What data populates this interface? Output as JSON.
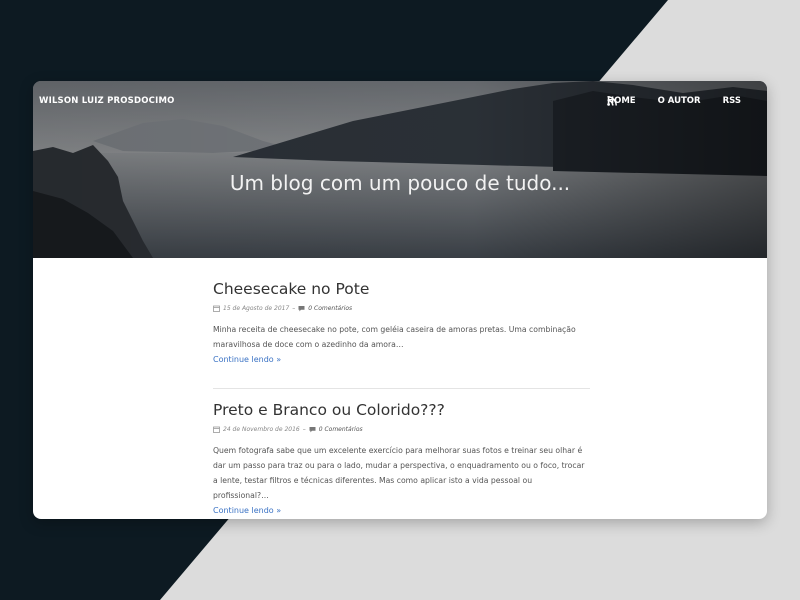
{
  "site": {
    "brand": "WILSON LUIZ PROSDOCIMO",
    "tagline": "Um blog com um pouco de tudo...",
    "nav": [
      {
        "label": "HOME"
      },
      {
        "label": "O AUTOR"
      },
      {
        "label": "RSS",
        "icon": "rss-icon"
      }
    ]
  },
  "posts": [
    {
      "title": "Cheesecake no Pote",
      "date": "15 de Agosto de 2017",
      "separator": "–",
      "comments": "0 Comentários",
      "excerpt": "Minha receita de cheesecake no pote, com geléia caseira de amoras pretas. Uma combinação maravilhosa de doce com o azedinho da amora…",
      "more": "Continue lendo »"
    },
    {
      "title": "Preto e Branco ou Colorido???",
      "date": "24 de Novembro de 2016",
      "separator": "–",
      "comments": "0 Comentários",
      "excerpt": "Quem fotografa sabe que um excelente exercício para melhorar suas fotos e treinar seu olhar é dar um passo para traz ou para o lado, mudar a perspectiva, o enquadramento ou o foco, trocar a lente, testar filtros e técnicas diferentes. Mas como aplicar isto a vida pessoal ou profissional?…",
      "more": "Continue lendo »"
    }
  ],
  "colors": {
    "link": "#3a72c4",
    "background_dark": "#0d1a22",
    "background_light": "#dcdcdc"
  }
}
